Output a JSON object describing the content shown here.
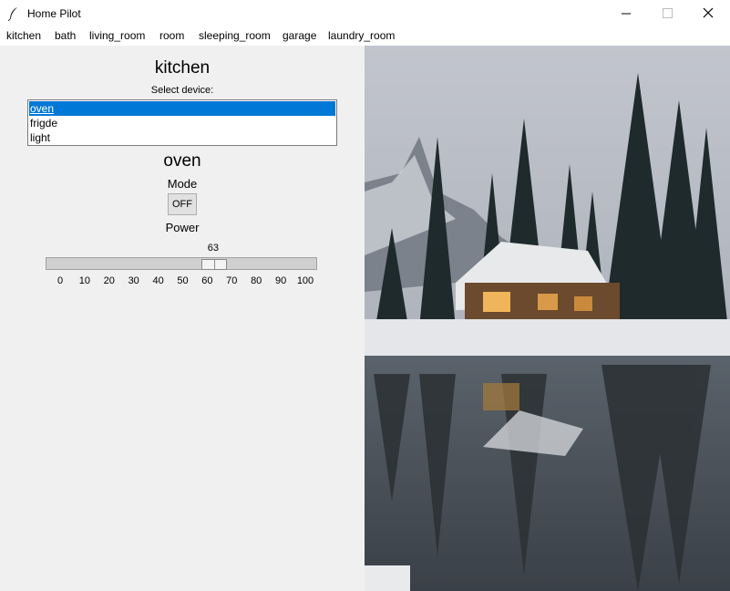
{
  "window": {
    "title": "Home Pilot"
  },
  "menu": [
    "kitchen",
    "bath",
    "living_room",
    "room",
    "sleeping_room",
    "garage",
    "laundry_room"
  ],
  "room": {
    "title": "kitchen",
    "select_label": "Select device:"
  },
  "devices": [
    "oven",
    "frigde",
    "light"
  ],
  "selected_device_index": 0,
  "device": {
    "title": "oven",
    "mode_label": "Mode",
    "mode_button": "OFF",
    "power_label": "Power",
    "power_value": 63,
    "power_min": 0,
    "power_max": 100,
    "ticks": [
      "0",
      "10",
      "20",
      "30",
      "40",
      "50",
      "60",
      "70",
      "80",
      "90",
      "100"
    ]
  },
  "colors": {
    "selection": "#0078d7",
    "background": "#f0f0f0"
  },
  "icons": {
    "app": "feather-icon",
    "minimize": "minimize-icon",
    "maximize": "maximize-icon",
    "close": "close-icon"
  }
}
